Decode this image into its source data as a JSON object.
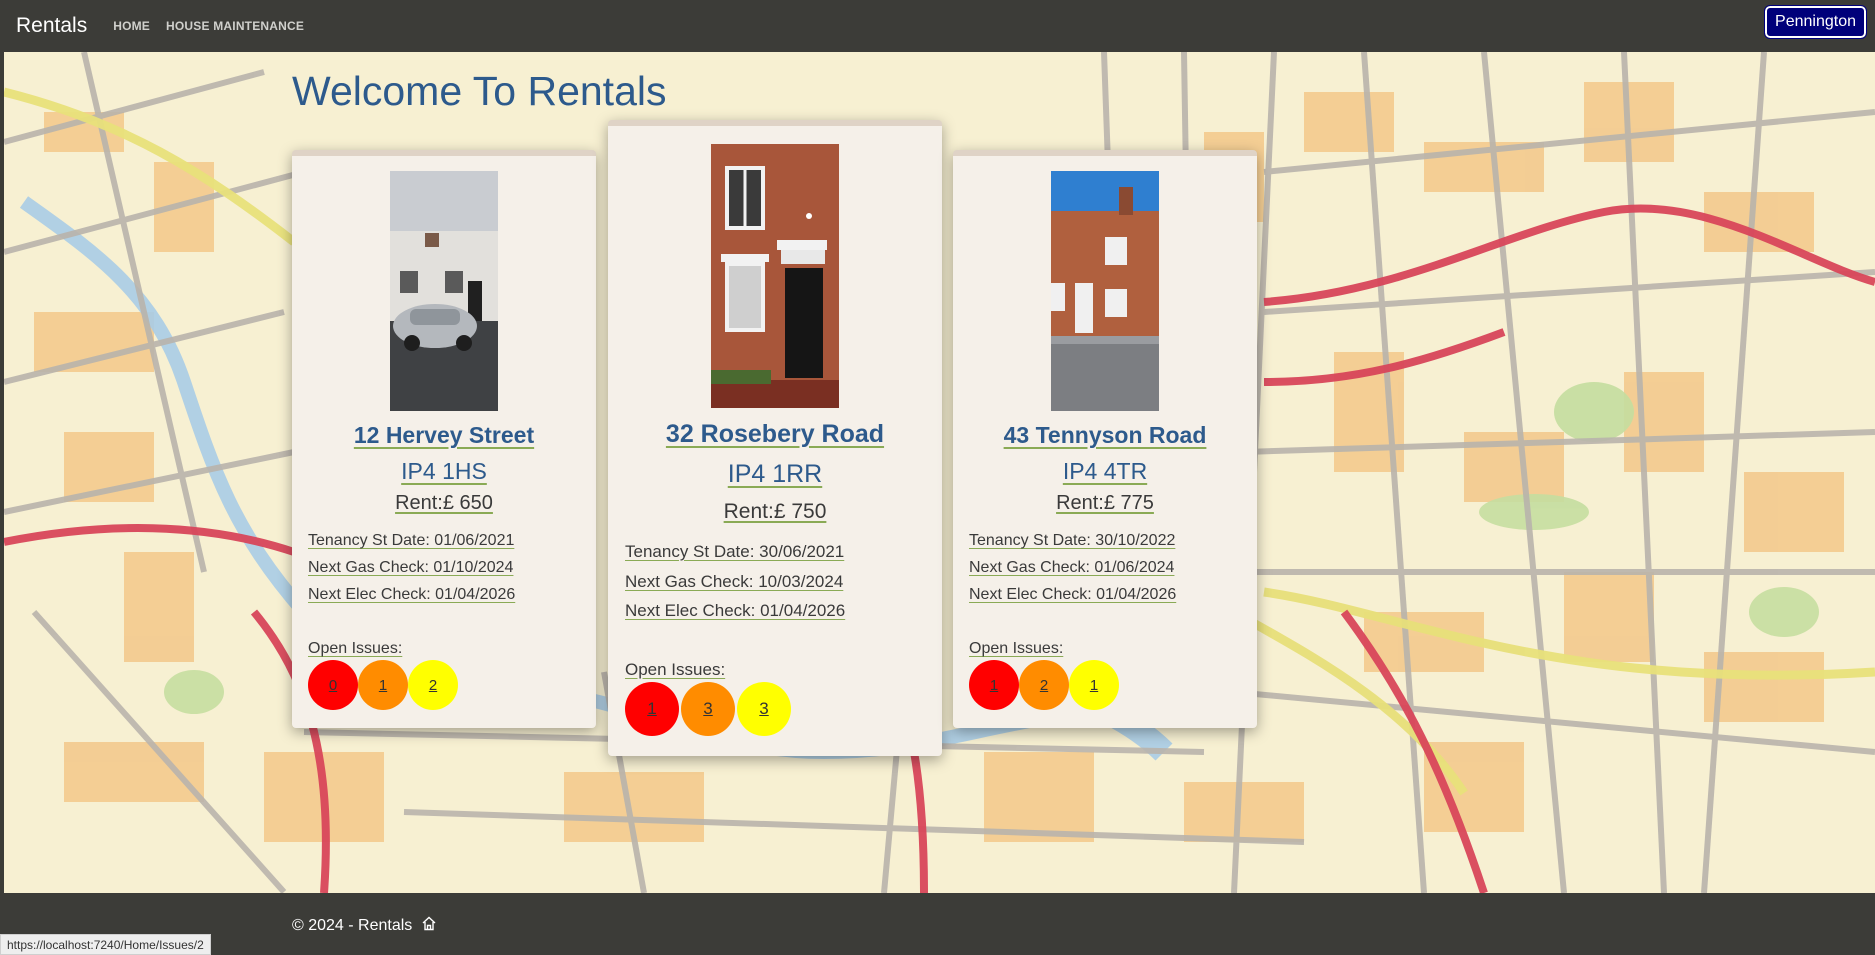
{
  "nav": {
    "brand": "Rentals",
    "links": [
      "HOME",
      "HOUSE MAINTENANCE"
    ],
    "user": "Pennington"
  },
  "page": {
    "title": "Welcome To Rentals"
  },
  "properties": [
    {
      "street": "12 Hervey Street",
      "postcode": "IP4 1HS",
      "rent": "Rent:£ 650",
      "tenancy": "Tenancy St Date: 01/06/2021",
      "gas": "Next Gas Check: 01/10/2024",
      "elec": "Next Elec Check: 01/04/2026",
      "issues_label": "Open Issues:",
      "issues": [
        "0",
        "1",
        "2"
      ]
    },
    {
      "street": "32 Rosebery Road",
      "postcode": "IP4 1RR",
      "rent": "Rent:£ 750",
      "tenancy": "Tenancy St Date: 30/06/2021",
      "gas": "Next Gas Check: 10/03/2024",
      "elec": "Next Elec Check: 01/04/2026",
      "issues_label": "Open Issues:",
      "issues": [
        "1",
        "3",
        "3"
      ]
    },
    {
      "street": "43 Tennyson Road",
      "postcode": "IP4 4TR",
      "rent": "Rent:£ 775",
      "tenancy": "Tenancy St Date: 30/10/2022",
      "gas": "Next Gas Check: 01/06/2024",
      "elec": "Next Elec Check: 01/04/2026",
      "issues_label": "Open Issues:",
      "issues": [
        "1",
        "2",
        "1"
      ]
    }
  ],
  "footer": {
    "text": "© 2024 - Rentals",
    "icon": "home-icon"
  },
  "status_bar": {
    "url": "https://localhost:7240/Home/Issues/2"
  },
  "colors": {
    "navbar": "#3c3c38",
    "title": "#2d5a8c",
    "user_button": "#00007a",
    "issue_high": "#ff0000",
    "issue_medium": "#ff8c00",
    "issue_low": "#ffff00"
  }
}
